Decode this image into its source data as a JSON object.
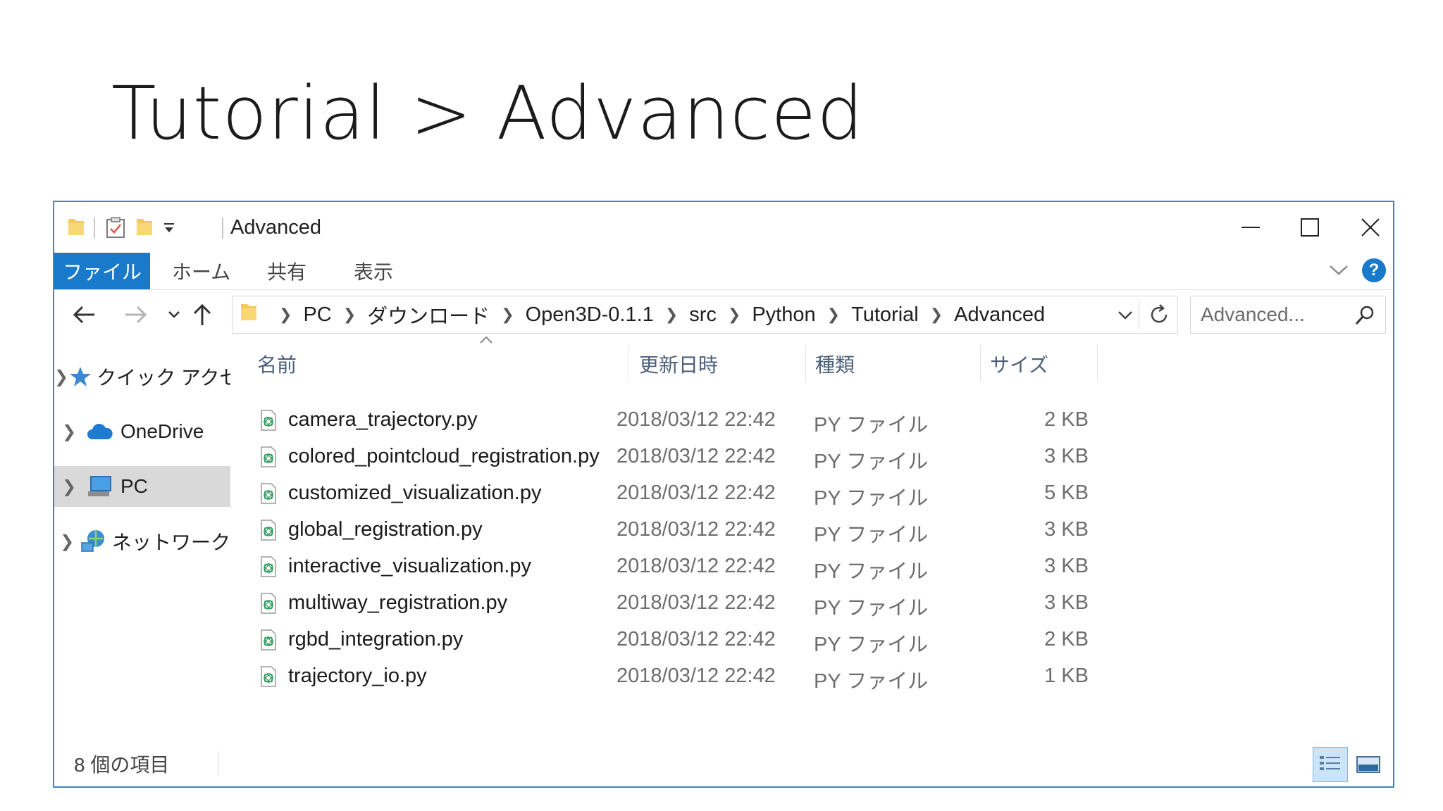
{
  "slide": {
    "title": "Tutorial > Advanced"
  },
  "window": {
    "title": "Advanced",
    "accent_color": "#1979ca",
    "border_color": "#3c87c9"
  },
  "ribbon": {
    "tabs": [
      "ファイル",
      "ホーム",
      "共有",
      "表示"
    ],
    "help_label": "?"
  },
  "address": {
    "crumbs": [
      "PC",
      "ダウンロード",
      "Open3D-0.1.1",
      "src",
      "Python",
      "Tutorial",
      "Advanced"
    ]
  },
  "search": {
    "placeholder": "Advanced..."
  },
  "navpane": {
    "items": [
      {
        "label": "クイック アクセス",
        "icon": "star-icon"
      },
      {
        "label": "OneDrive",
        "icon": "cloud-icon"
      },
      {
        "label": "PC",
        "icon": "computer-icon",
        "selected": true
      },
      {
        "label": "ネットワーク",
        "icon": "network-icon"
      }
    ]
  },
  "columns": {
    "name": "名前",
    "date": "更新日時",
    "type": "種類",
    "size": "サイズ"
  },
  "files": [
    {
      "name": "camera_trajectory.py",
      "date": "2018/03/12 22:42",
      "type": "PY ファイル",
      "size": "2 KB"
    },
    {
      "name": "colored_pointcloud_registration.py",
      "date": "2018/03/12 22:42",
      "type": "PY ファイル",
      "size": "3 KB"
    },
    {
      "name": "customized_visualization.py",
      "date": "2018/03/12 22:42",
      "type": "PY ファイル",
      "size": "5 KB"
    },
    {
      "name": "global_registration.py",
      "date": "2018/03/12 22:42",
      "type": "PY ファイル",
      "size": "3 KB"
    },
    {
      "name": "interactive_visualization.py",
      "date": "2018/03/12 22:42",
      "type": "PY ファイル",
      "size": "3 KB"
    },
    {
      "name": "multiway_registration.py",
      "date": "2018/03/12 22:42",
      "type": "PY ファイル",
      "size": "3 KB"
    },
    {
      "name": "rgbd_integration.py",
      "date": "2018/03/12 22:42",
      "type": "PY ファイル",
      "size": "2 KB"
    },
    {
      "name": "trajectory_io.py",
      "date": "2018/03/12 22:42",
      "type": "PY ファイル",
      "size": "1 KB"
    }
  ],
  "status": {
    "item_count": "8 個の項目"
  }
}
